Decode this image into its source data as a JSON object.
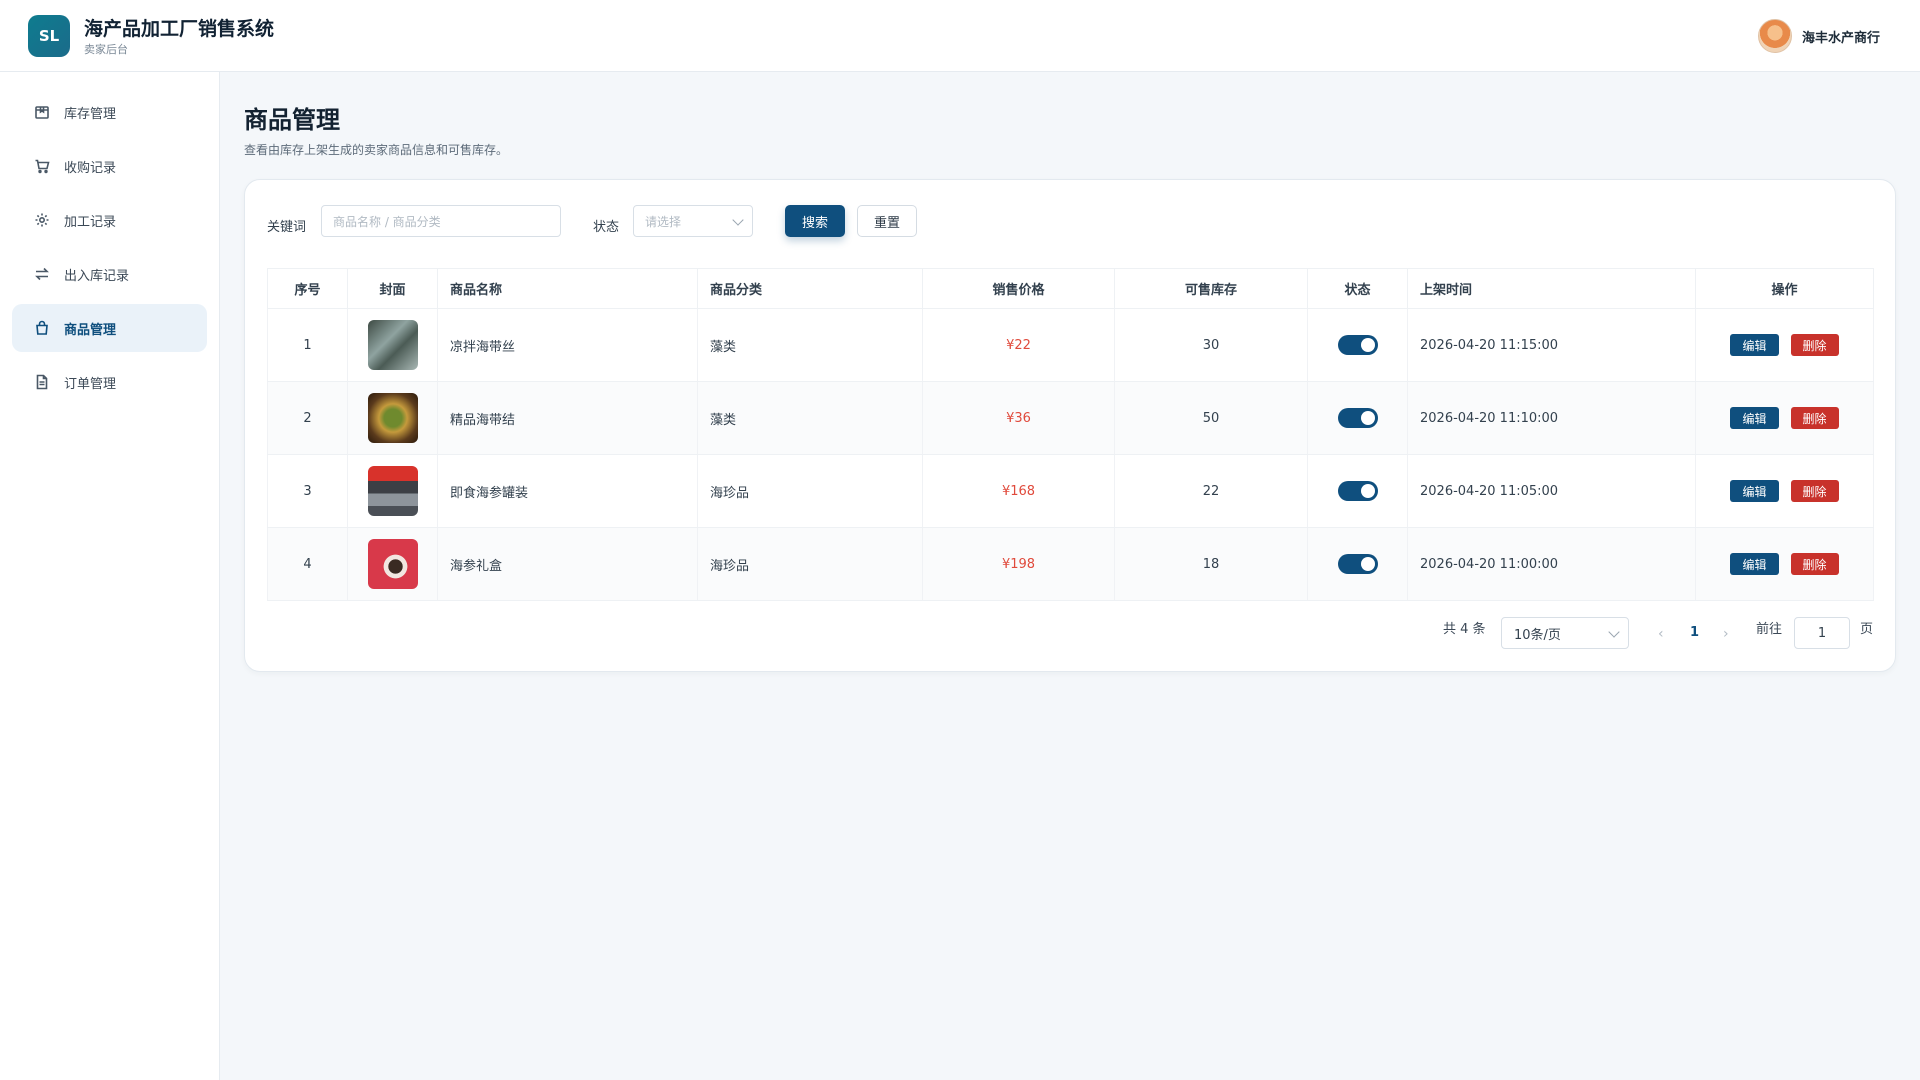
{
  "app": {
    "logo": "SL",
    "title": "海产品加工厂销售系统",
    "subtitle": "卖家后台"
  },
  "user": {
    "name": "海丰水产商行"
  },
  "sidebar": {
    "items": [
      {
        "label": "库存管理",
        "icon": "box-icon"
      },
      {
        "label": "收购记录",
        "icon": "cart-icon"
      },
      {
        "label": "加工记录",
        "icon": "gear-icon"
      },
      {
        "label": "出入库记录",
        "icon": "swap-icon"
      },
      {
        "label": "商品管理",
        "icon": "bag-icon",
        "active": true
      },
      {
        "label": "订单管理",
        "icon": "document-icon"
      }
    ]
  },
  "page": {
    "title": "商品管理",
    "description": "查看由库存上架生成的卖家商品信息和可售库存。"
  },
  "filters": {
    "keyword_label": "关键词",
    "keyword_placeholder": "商品名称 / 商品分类",
    "status_label": "状态",
    "status_placeholder": "请选择",
    "search_label": "搜索",
    "reset_label": "重置"
  },
  "table": {
    "columns": [
      "序号",
      "封面",
      "商品名称",
      "商品分类",
      "销售价格",
      "可售库存",
      "状态",
      "上架时间",
      "操作"
    ],
    "rows": [
      {
        "index": "1",
        "name": "凉拌海带丝",
        "category": "藻类",
        "price": "¥22",
        "stock": "30",
        "status": "on",
        "time": "2026-04-20 11:15:00"
      },
      {
        "index": "2",
        "name": "精品海带结",
        "category": "藻类",
        "price": "¥36",
        "stock": "50",
        "status": "on",
        "time": "2026-04-20 11:10:00"
      },
      {
        "index": "3",
        "name": "即食海参罐装",
        "category": "海珍品",
        "price": "¥168",
        "stock": "22",
        "status": "on",
        "time": "2026-04-20 11:05:00"
      },
      {
        "index": "4",
        "name": "海参礼盒",
        "category": "海珍品",
        "price": "¥198",
        "stock": "18",
        "status": "on",
        "time": "2026-04-20 11:00:00"
      }
    ],
    "edit_label": "编辑",
    "delete_label": "删除"
  },
  "pagination": {
    "total": "共 4 条",
    "page_size": "10条/页",
    "current_page": "1",
    "goto_label": "前往",
    "goto_value": "1",
    "page_suffix": "页"
  },
  "colors": {
    "primary": "#0f4f7e",
    "danger": "#c8322b",
    "price": "#e04a3c"
  }
}
